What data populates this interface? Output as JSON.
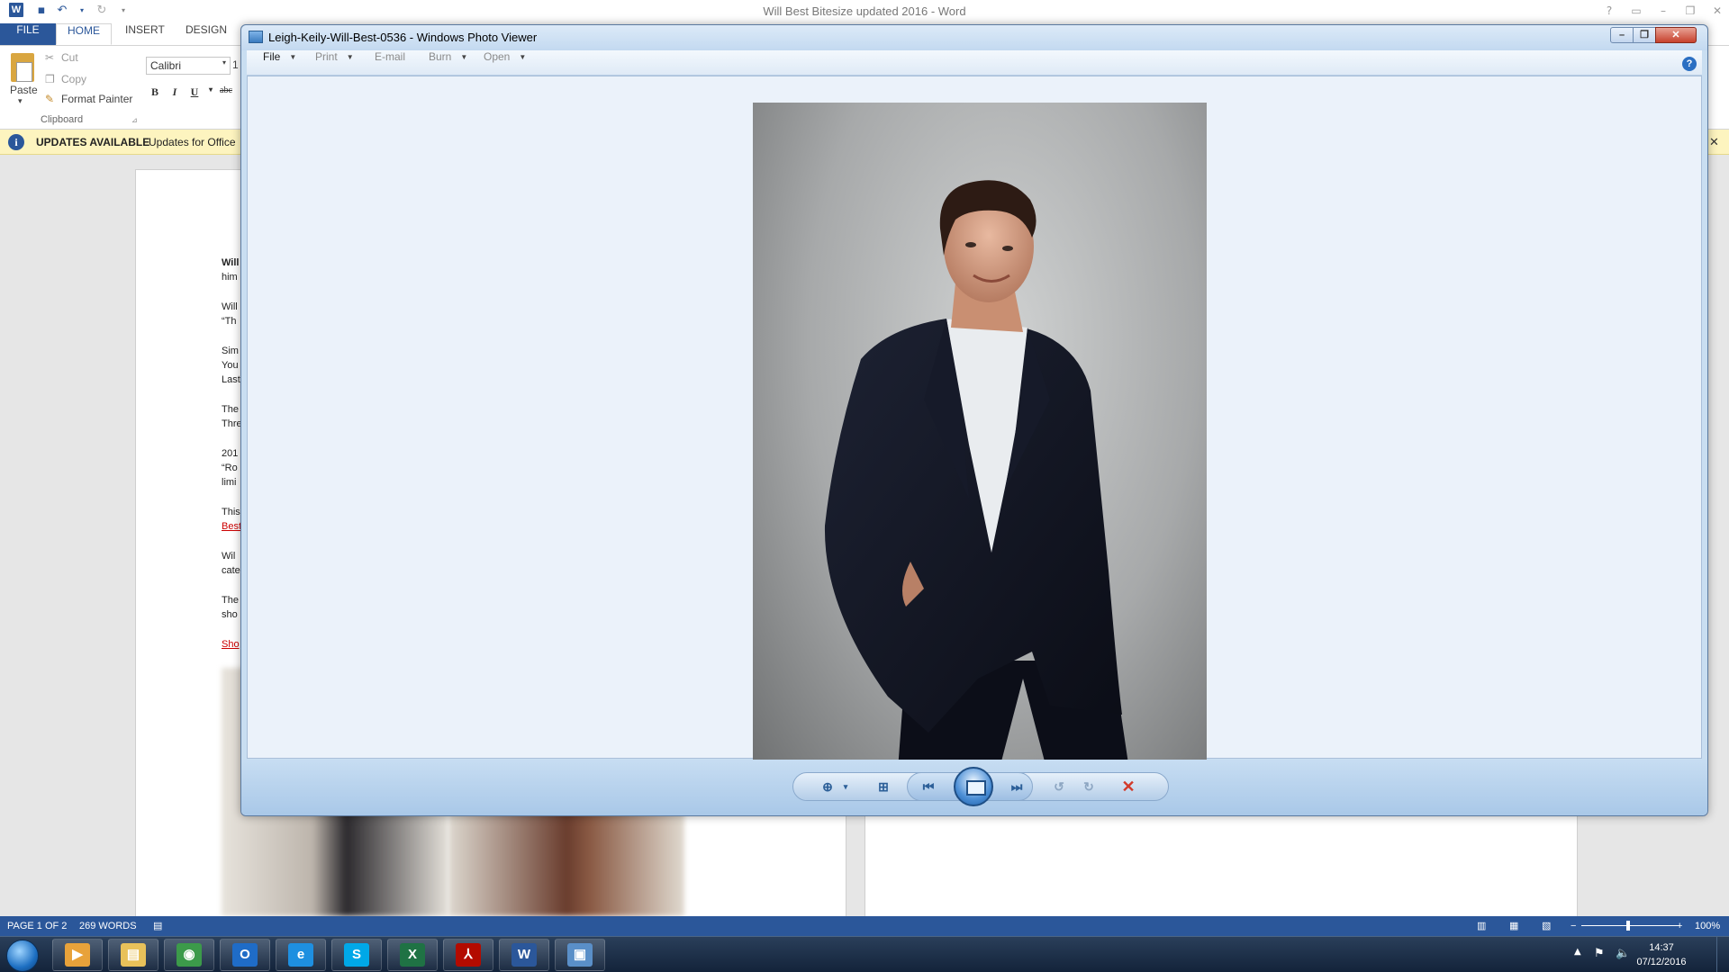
{
  "word": {
    "window_title": "Will Best Bitesize updated 2016 - Word",
    "logo_letter": "W",
    "title_controls": [
      "?",
      "▭",
      "–",
      "❐",
      "✕"
    ],
    "ribbon_tabs": [
      "FILE",
      "HOME",
      "INSERT",
      "DESIGN"
    ],
    "active_tab": "HOME",
    "clipboard": {
      "paste": "Paste",
      "cut": "Cut",
      "copy": "Copy",
      "format_painter": "Format Painter",
      "group_label": "Clipboard"
    },
    "font_name": "Calibri",
    "font_size_partial": "1",
    "format_buttons": [
      "B",
      "I",
      "U",
      "abc"
    ],
    "updates": {
      "title": "UPDATES AVAILABLE",
      "message": "Updates for Office"
    },
    "doc_lines": [
      {
        "text": "Will",
        "style": "bold"
      },
      {
        "text": "him",
        "style": ""
      },
      {
        "text": "Will",
        "style": ""
      },
      {
        "text": "“Th",
        "style": ""
      },
      {
        "text": "Sim",
        "style": ""
      },
      {
        "text": "You",
        "style": ""
      },
      {
        "text": "Last",
        "style": ""
      },
      {
        "text": "The",
        "style": ""
      },
      {
        "text": "Thre",
        "style": ""
      },
      {
        "text": "201",
        "style": ""
      },
      {
        "text": "“Ro",
        "style": ""
      },
      {
        "text": "limi",
        "style": ""
      },
      {
        "text": "This",
        "style": ""
      },
      {
        "text": "Best",
        "style": "link"
      },
      {
        "text": " Wil",
        "style": ""
      },
      {
        "text": "cate",
        "style": ""
      },
      {
        "text": "The",
        "style": ""
      },
      {
        "text": "sho",
        "style": ""
      },
      {
        "text": "Sho",
        "style": "link"
      }
    ],
    "status": {
      "page": "PAGE 1 OF 2",
      "words": "269 WORDS",
      "zoom": "100%"
    }
  },
  "viewer": {
    "title": "Leigh-Keily-Will-Best-0536 - Windows Photo Viewer",
    "window_controls": [
      "–",
      "❐",
      "✕"
    ],
    "menu": [
      {
        "label": "File",
        "enabled": true,
        "has_dropdown": true
      },
      {
        "label": "Print",
        "enabled": false,
        "has_dropdown": true
      },
      {
        "label": "E-mail",
        "enabled": false,
        "has_dropdown": false
      },
      {
        "label": "Burn",
        "enabled": false,
        "has_dropdown": true
      },
      {
        "label": "Open",
        "enabled": false,
        "has_dropdown": true
      }
    ],
    "help": "?",
    "controls": {
      "zoom_icon": "magnifier-icon",
      "fit_icon": "actual-size-icon",
      "prev_icon": "previous-icon",
      "slideshow_icon": "slideshow-icon",
      "next_icon": "next-icon",
      "rotate_ccw_icon": "rotate-counterclockwise-icon",
      "rotate_cw_icon": "rotate-clockwise-icon",
      "delete_icon": "delete-icon"
    },
    "photo_alt": "Portrait of a man in a dark suit and white shirt against a grey backdrop"
  },
  "taskbar": {
    "apps": [
      {
        "name": "media-player",
        "label": "▶",
        "color": "#e8a23a"
      },
      {
        "name": "file-explorer",
        "label": "▤",
        "color": "#e8c15a"
      },
      {
        "name": "chrome",
        "label": "◉",
        "color": "#3c9a4a"
      },
      {
        "name": "outlook",
        "label": "O",
        "color": "#1f6cc7"
      },
      {
        "name": "internet-explorer",
        "label": "e",
        "color": "#1e8fe0"
      },
      {
        "name": "skype",
        "label": "S",
        "color": "#00a8e8"
      },
      {
        "name": "excel",
        "label": "X",
        "color": "#1f7244"
      },
      {
        "name": "acrobat",
        "label": "⅄",
        "color": "#b30b00"
      },
      {
        "name": "word",
        "label": "W",
        "color": "#2b579a"
      },
      {
        "name": "photo-viewer",
        "label": "▣",
        "color": "#5a8fc8"
      }
    ],
    "time": "14:37",
    "date": "07/12/2016"
  }
}
